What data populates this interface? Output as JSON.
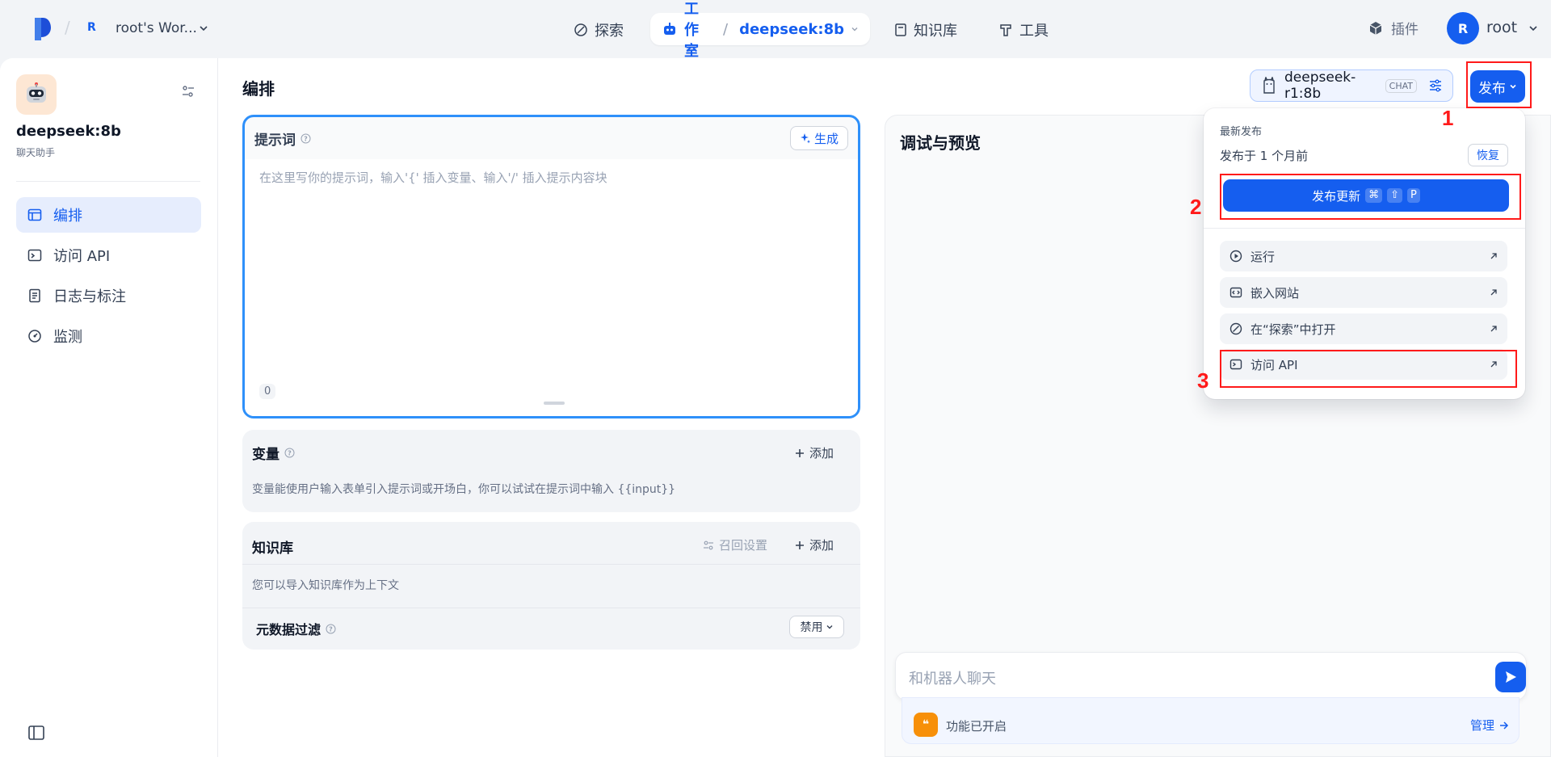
{
  "nav": {
    "workspace_initial": "R",
    "workspace_name": "root's Wor...",
    "explore": "探索",
    "studio": "工作室",
    "current_app": "deepseek:8b",
    "knowledge": "知识库",
    "tools": "工具",
    "plugins": "插件",
    "user_initial": "R",
    "user_name": "root"
  },
  "sidebar": {
    "app_name": "deepseek:8b",
    "app_type": "聊天助手",
    "items": [
      {
        "label": "编排",
        "icon": "layout-icon",
        "active": true
      },
      {
        "label": "访问 API",
        "icon": "terminal-icon",
        "active": false
      },
      {
        "label": "日志与标注",
        "icon": "file-list-icon",
        "active": false
      },
      {
        "label": "监测",
        "icon": "gauge-icon",
        "active": false
      }
    ]
  },
  "main": {
    "title": "编排",
    "model_name": "deepseek-r1:8b",
    "model_mode": "CHAT",
    "publish_label": "发布"
  },
  "prompt": {
    "title": "提示词",
    "generate_label": "生成",
    "placeholder": "在这里写你的提示词，输入'{' 插入变量、输入'/' 插入提示内容块",
    "char_count": "0"
  },
  "variables": {
    "title": "变量",
    "add_label": "添加",
    "description": "变量能使用户输入表单引入提示词或开场白，你可以试试在提示词中输入 {{input}}"
  },
  "knowledge": {
    "title": "知识库",
    "recall_label": "召回设置",
    "add_label": "添加",
    "description": "您可以导入知识库作为上下文",
    "metadata_title": "元数据过滤",
    "metadata_value": "禁用"
  },
  "debug": {
    "title": "调试与预览",
    "chat_placeholder": "和机器人聊天",
    "feature_label": "功能已开启",
    "manage_label": "管理"
  },
  "publish_menu": {
    "latest_label": "最新发布",
    "published_time": "发布于 1 个月前",
    "restore_label": "恢复",
    "update_label": "发布更新",
    "shortcut_keys": [
      "⌘",
      "⇧",
      "P"
    ],
    "items": [
      {
        "label": "运行",
        "icon": "play-circle-icon"
      },
      {
        "label": "嵌入网站",
        "icon": "code-window-icon"
      },
      {
        "label": "在“探索”中打开",
        "icon": "compass-icon"
      },
      {
        "label": "访问 API",
        "icon": "terminal-icon"
      }
    ]
  },
  "annotations": {
    "step1": "1",
    "step2": "2",
    "step3": "3"
  },
  "colors": {
    "accent": "#155eef",
    "annotation_red": "#ff1a1a"
  }
}
